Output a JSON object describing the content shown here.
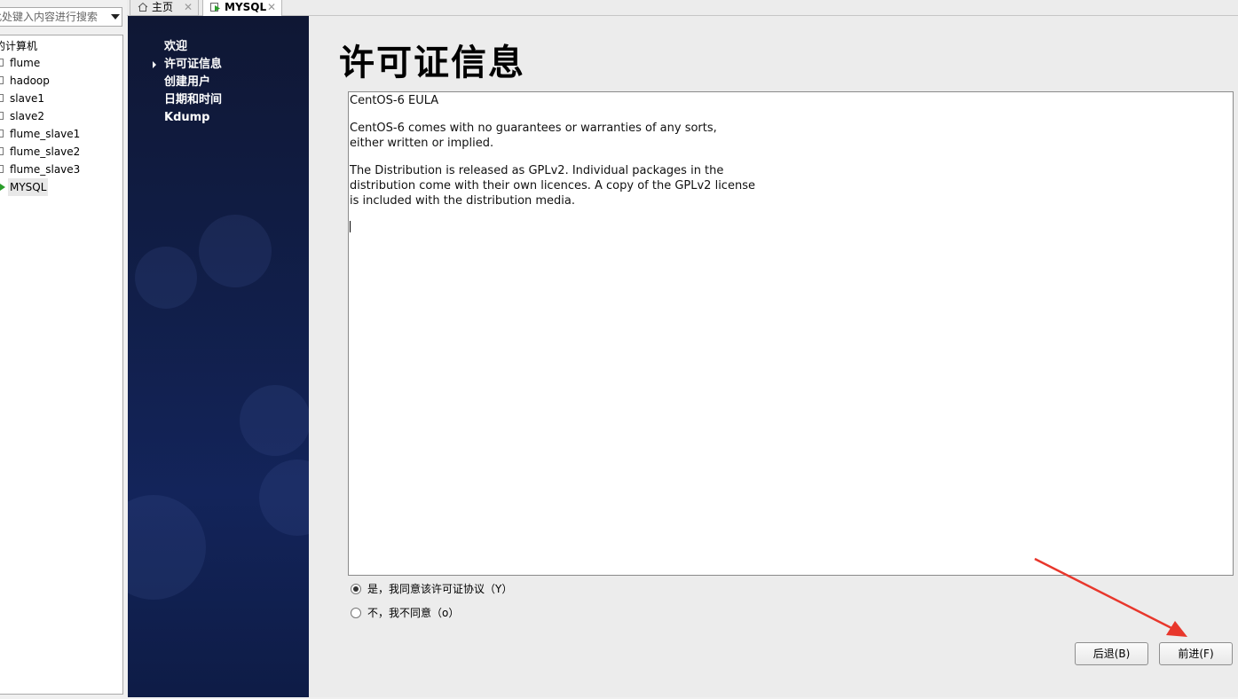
{
  "library": {
    "search": {
      "placeholder": "在此处键入内容进行搜索",
      "visible_placeholder": "此处键入内容进行搜索"
    },
    "root_label": "我的计算机",
    "root_visible": "的计算机",
    "vms": [
      {
        "name": "flume",
        "state": "off"
      },
      {
        "name": "hadoop",
        "state": "off"
      },
      {
        "name": "slave1",
        "state": "off"
      },
      {
        "name": "slave2",
        "state": "off"
      },
      {
        "name": "flume_slave1",
        "state": "off"
      },
      {
        "name": "flume_slave2",
        "state": "off"
      },
      {
        "name": "flume_slave3",
        "state": "off"
      },
      {
        "name": "MYSQL",
        "state": "running",
        "selected": true
      }
    ]
  },
  "tabs": [
    {
      "label": "主页",
      "icon": "home-icon",
      "active": false
    },
    {
      "label": "MYSQL",
      "icon": "vm-running-icon",
      "active": true
    }
  ],
  "installer": {
    "steps": [
      {
        "label": "欢迎",
        "current": false
      },
      {
        "label": "许可证信息",
        "current": true
      },
      {
        "label": "创建用户",
        "current": false
      },
      {
        "label": "日期和时间",
        "current": false
      },
      {
        "label": "Kdump",
        "current": false
      }
    ],
    "title": "许可证信息",
    "license_paragraphs": [
      "CentOS-6 EULA",
      "CentOS-6 comes with no guarantees or warranties of any sorts,\neither written or implied.",
      "The Distribution is released as GPLv2. Individual packages in the\ndistribution come with their own licences. A copy of the GPLv2 license\nis included with the distribution media."
    ],
    "agree_label": "是，我同意该许可证协议（Y）",
    "disagree_label": "不，我不同意（o）",
    "selected_option": "agree",
    "back_button": "后退(B)",
    "forward_button": "前进(F)"
  },
  "colors": {
    "annotation_arrow": "#e8372c",
    "sidebar_bg": "#111f4b",
    "running_icon": "#2a9d2a"
  }
}
